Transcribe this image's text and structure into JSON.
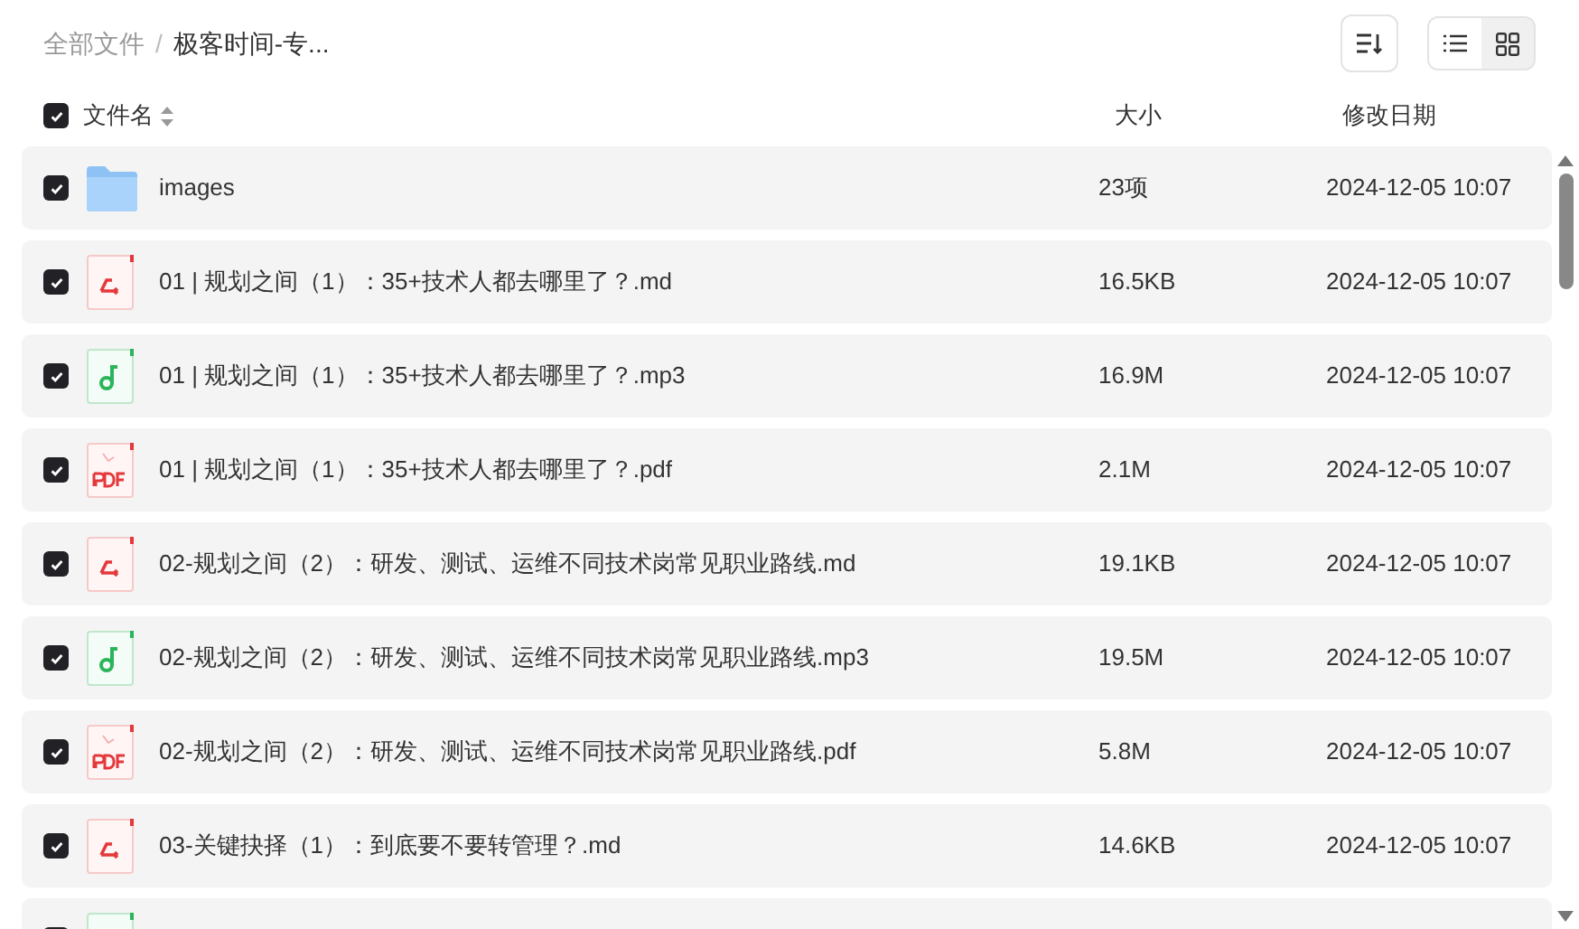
{
  "breadcrumb": [
    {
      "label": "全部文件",
      "current": false
    },
    {
      "label": "极客时间-专...",
      "current": true
    }
  ],
  "breadcrumb_separator": "/",
  "view_modes": [
    {
      "kind": "list",
      "selected": true
    },
    {
      "kind": "grid",
      "selected": false
    }
  ],
  "header": {
    "checked": true,
    "columns": [
      "文件名",
      "大小",
      "修改日期"
    ]
  },
  "rows": [
    {
      "kind": "folder",
      "checked": true,
      "name": "images",
      "size": "23项",
      "date": "2024-12-05 10:07"
    },
    {
      "kind": "markdown",
      "checked": true,
      "name": "01 | 规划之间（1）：35+技术人都去哪里了？.md",
      "size": "16.5KB",
      "date": "2024-12-05 10:07"
    },
    {
      "kind": "audio",
      "checked": true,
      "name": "01 | 规划之间（1）：35+技术人都去哪里了？.mp3",
      "size": "16.9M",
      "date": "2024-12-05 10:07"
    },
    {
      "kind": "pdf",
      "checked": true,
      "name": "01 | 规划之间（1）：35+技术人都去哪里了？.pdf",
      "size": "2.1M",
      "date": "2024-12-05 10:07"
    },
    {
      "kind": "markdown",
      "checked": true,
      "name": "02-规划之间（2）：研发、测试、运维不同技术岗常见职业路线.md",
      "size": "19.1KB",
      "date": "2024-12-05 10:07"
    },
    {
      "kind": "audio",
      "checked": true,
      "name": "02-规划之间（2）：研发、测试、运维不同技术岗常见职业路线.mp3",
      "size": "19.5M",
      "date": "2024-12-05 10:07"
    },
    {
      "kind": "pdf",
      "checked": true,
      "name": "02-规划之间（2）：研发、测试、运维不同技术岗常见职业路线.pdf",
      "size": "5.8M",
      "date": "2024-12-05 10:07"
    },
    {
      "kind": "markdown",
      "checked": true,
      "name": "03-关键抉择（1）：到底要不要转管理？.md",
      "size": "14.6KB",
      "date": "2024-12-05 10:07"
    },
    {
      "kind": "audio",
      "checked": true
    }
  ]
}
